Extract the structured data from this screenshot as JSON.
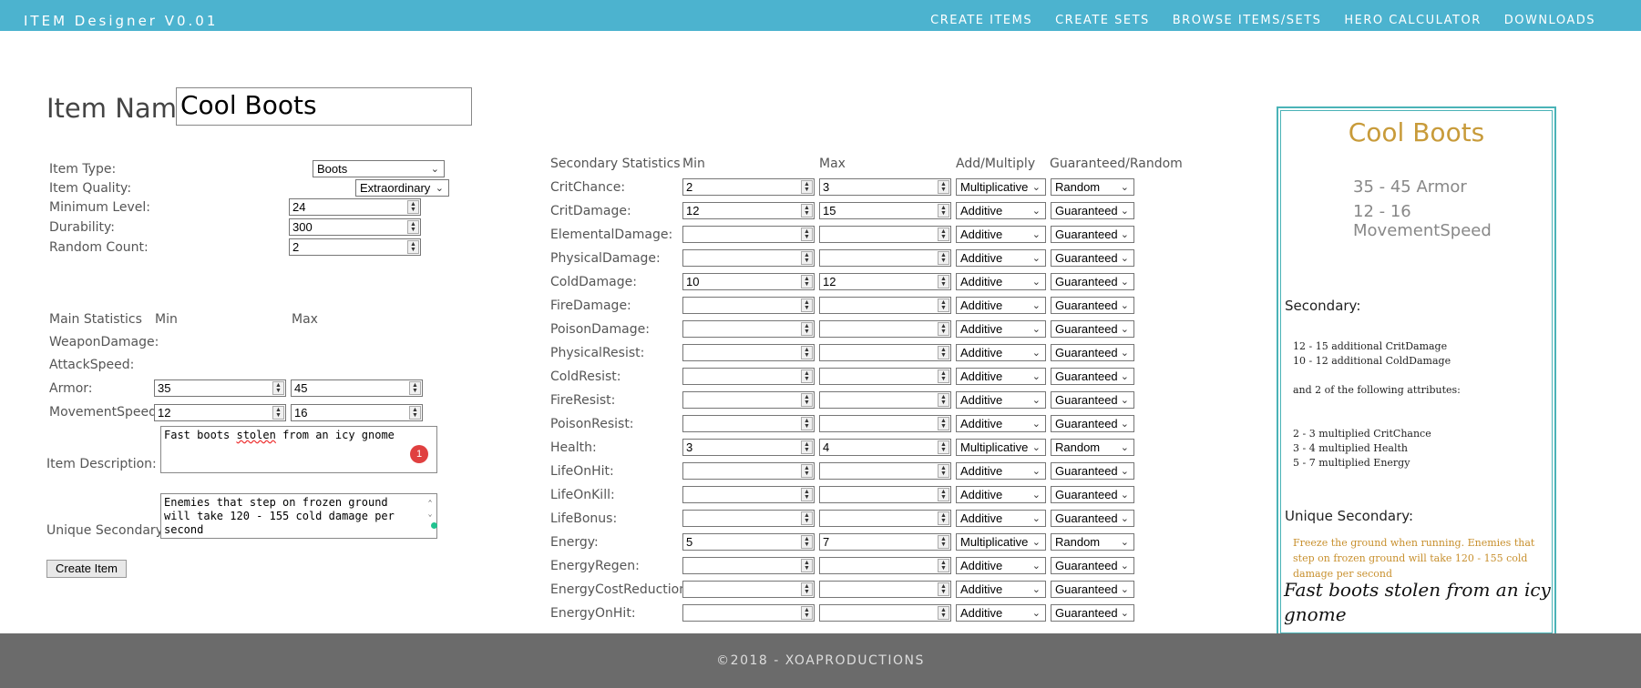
{
  "app": {
    "title": "ITEM Designer V0.01",
    "nav": [
      "CREATE ITEMS",
      "CREATE SETS",
      "BROWSE ITEMS/SETS",
      "HERO CALCULATOR",
      "DOWNLOADS"
    ]
  },
  "item_name": {
    "label": "Item Name:",
    "value": "Cool Boots"
  },
  "basic": {
    "type_label": "Item Type:",
    "type_value": "Boots",
    "quality_label": "Item Quality:",
    "quality_value": "Extraordinary",
    "minlevel_label": "Minimum Level:",
    "minlevel_value": "24",
    "durability_label": "Durability:",
    "durability_value": "300",
    "randomcount_label": "Random Count:",
    "randomcount_value": "2"
  },
  "main_stats": {
    "header": "Main Statistics",
    "min_header": "Min",
    "max_header": "Max",
    "rows": [
      {
        "label": "WeaponDamage:",
        "min": null,
        "max": null
      },
      {
        "label": "AttackSpeed:",
        "min": null,
        "max": null
      },
      {
        "label": "Armor:",
        "min": "35",
        "max": "45"
      },
      {
        "label": "MovementSpeed:",
        "min": "12",
        "max": "16"
      }
    ]
  },
  "description": {
    "label": "Item Description:",
    "pre": "Fast boots ",
    "misspelled": "stolen",
    "post": " from an icy gnome",
    "badge": "1"
  },
  "unique": {
    "label": "Unique Secondary:",
    "value": "Enemies that step on frozen ground will take 120 - 155 cold damage per second"
  },
  "create_button": "Create Item",
  "secondary": {
    "headers": {
      "stat": "Secondary Statistics",
      "min": "Min",
      "max": "Max",
      "op": "Add/Multiply",
      "gr": "Guaranteed/Random"
    },
    "rows": [
      {
        "label": "CritChance:",
        "min": "2",
        "max": "3",
        "op": "Multiplicative",
        "gr": "Random"
      },
      {
        "label": "CritDamage:",
        "min": "12",
        "max": "15",
        "op": "Additive",
        "gr": "Guaranteed"
      },
      {
        "label": "ElementalDamage:",
        "min": "",
        "max": "",
        "op": "Additive",
        "gr": "Guaranteed"
      },
      {
        "label": "PhysicalDamage:",
        "min": "",
        "max": "",
        "op": "Additive",
        "gr": "Guaranteed"
      },
      {
        "label": "ColdDamage:",
        "min": "10",
        "max": "12",
        "op": "Additive",
        "gr": "Guaranteed"
      },
      {
        "label": "FireDamage:",
        "min": "",
        "max": "",
        "op": "Additive",
        "gr": "Guaranteed"
      },
      {
        "label": "PoisonDamage:",
        "min": "",
        "max": "",
        "op": "Additive",
        "gr": "Guaranteed"
      },
      {
        "label": "PhysicalResist:",
        "min": "",
        "max": "",
        "op": "Additive",
        "gr": "Guaranteed"
      },
      {
        "label": "ColdResist:",
        "min": "",
        "max": "",
        "op": "Additive",
        "gr": "Guaranteed"
      },
      {
        "label": "FireResist:",
        "min": "",
        "max": "",
        "op": "Additive",
        "gr": "Guaranteed"
      },
      {
        "label": "PoisonResist:",
        "min": "",
        "max": "",
        "op": "Additive",
        "gr": "Guaranteed"
      },
      {
        "label": "Health:",
        "min": "3",
        "max": "4",
        "op": "Multiplicative",
        "gr": "Random"
      },
      {
        "label": "LifeOnHit:",
        "min": "",
        "max": "",
        "op": "Additive",
        "gr": "Guaranteed"
      },
      {
        "label": "LifeOnKill:",
        "min": "",
        "max": "",
        "op": "Additive",
        "gr": "Guaranteed"
      },
      {
        "label": "LifeBonus:",
        "min": "",
        "max": "",
        "op": "Additive",
        "gr": "Guaranteed"
      },
      {
        "label": "Energy:",
        "min": "5",
        "max": "7",
        "op": "Multiplicative",
        "gr": "Random"
      },
      {
        "label": "EnergyRegen:",
        "min": "",
        "max": "",
        "op": "Additive",
        "gr": "Guaranteed"
      },
      {
        "label": "EnergyCostReduction:",
        "min": "",
        "max": "",
        "op": "Additive",
        "gr": "Guaranteed"
      },
      {
        "label": "EnergyOnHit:",
        "min": "",
        "max": "",
        "op": "Additive",
        "gr": "Guaranteed"
      }
    ]
  },
  "preview": {
    "title": "Cool Boots",
    "main_lines": [
      "35 - 45 Armor",
      "12 - 16 MovementSpeed"
    ],
    "secondary_heading": "Secondary:",
    "guaranteed_lines": [
      "12 - 15 additional CritDamage",
      "10 - 12 additional ColdDamage"
    ],
    "random_intro": "and 2 of the following attributes:",
    "random_lines": [
      "2 - 3 multiplied CritChance",
      "3 - 4 multiplied Health",
      "5 - 7 multiplied Energy"
    ],
    "unique_heading": "Unique Secondary:",
    "unique_text": "Freeze the ground when running. Enemies that step on frozen ground will take 120 - 155 cold damage per second",
    "description": "Fast boots stolen from an icy gnome"
  },
  "footer": "©2018 - XOAPRODUCTIONS",
  "colors": {
    "topbar": "#4cb3cf",
    "footer": "#6b6b6b",
    "accent_gold": "#c89b3a",
    "card_border": "#4ab3b7"
  }
}
